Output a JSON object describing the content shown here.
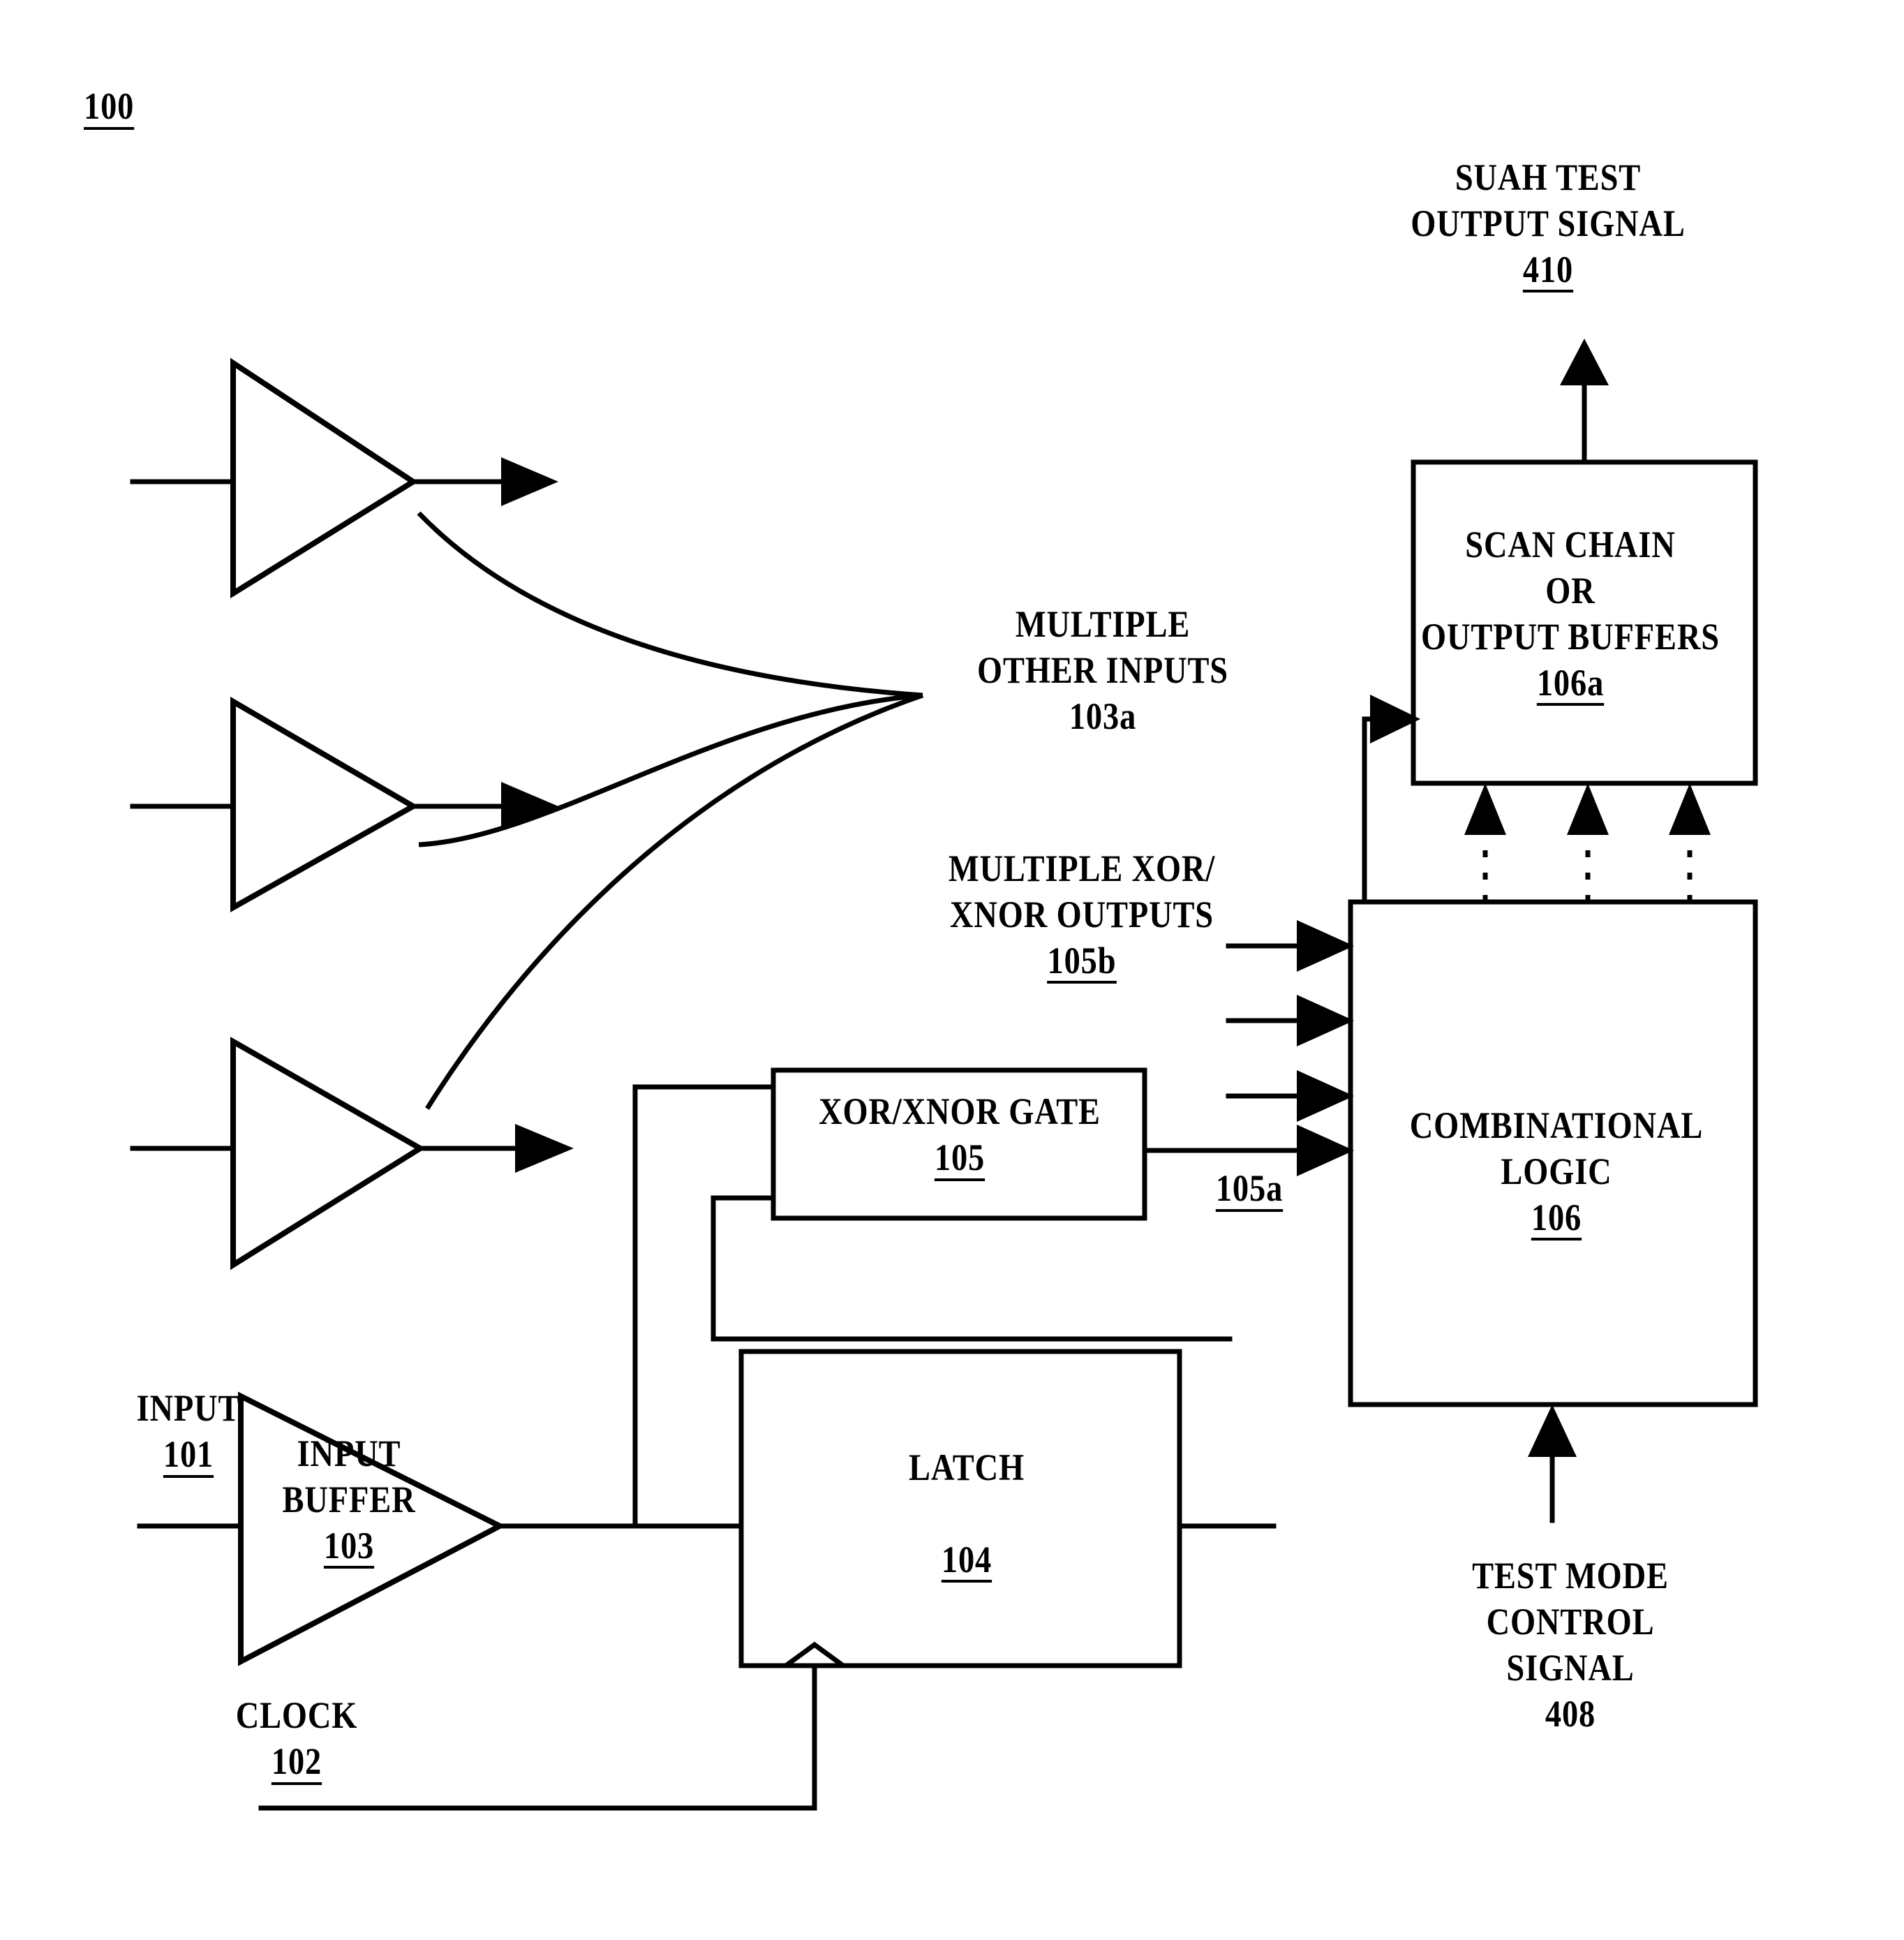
{
  "figure": {
    "number": "100",
    "number_underlined": true,
    "title": "Patent block diagram of input buffer test circuit"
  },
  "labels": {
    "suah_test_output": {
      "line1": "SUAH TEST",
      "line2": "OUTPUT SIGNAL",
      "ref": "410",
      "ref_underlined": true
    },
    "scan_chain": {
      "line1": "SCAN CHAIN",
      "line2": "OR",
      "line3": "OUTPUT BUFFERS",
      "ref": "106a",
      "ref_underlined": true
    },
    "multiple_other_inputs": {
      "line1": "MULTIPLE",
      "line2": "OTHER INPUTS",
      "ref": "103a",
      "ref_underlined": false
    },
    "multiple_xor_xnor_outputs": {
      "line1": "MULTIPLE XOR/",
      "line2": "XNOR OUTPUTS",
      "ref": "105b",
      "ref_underlined": true
    },
    "xor_xnor_gate": {
      "line1": "XOR/XNOR GATE",
      "ref": "105",
      "ref_underlined": true
    },
    "combinational_logic": {
      "line1": "COMBINATIONAL",
      "line2": "LOGIC",
      "ref": "106",
      "ref_underlined": true
    },
    "xor_output_net": {
      "ref": "105a",
      "ref_underlined": true
    },
    "latch": {
      "line1": "LATCH",
      "ref": "104",
      "ref_underlined": true
    },
    "input_signal": {
      "line1": "INPUT",
      "ref": "101",
      "ref_underlined": true
    },
    "input_buffer": {
      "line1": "INPUT",
      "line2": "BUFFER",
      "ref": "103",
      "ref_underlined": true
    },
    "clock": {
      "line1": "CLOCK",
      "ref": "102",
      "ref_underlined": true
    },
    "test_mode_control": {
      "line1": "TEST MODE",
      "line2": "CONTROL",
      "line3": "SIGNAL",
      "ref": "408",
      "ref_underlined": false
    }
  },
  "colors": {
    "ink": "#000000",
    "paper": "#ffffff"
  }
}
